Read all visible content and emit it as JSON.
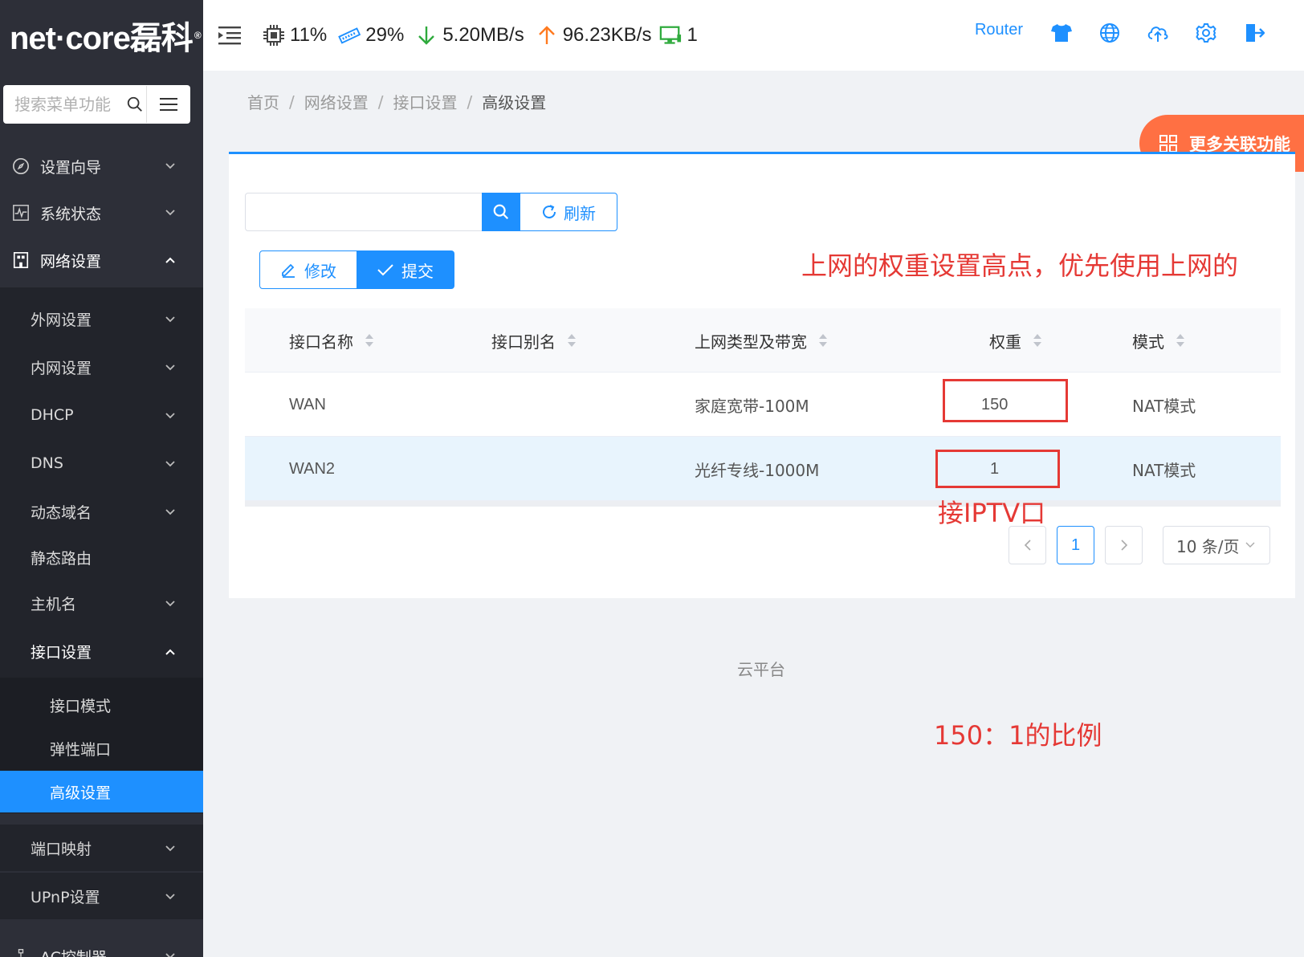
{
  "brand": {
    "logo_text": "net·core磊科",
    "reg": "®"
  },
  "sidebar": {
    "search_placeholder": "搜索菜单功能",
    "items": [
      {
        "label": "设置向导",
        "icon": "compass-icon"
      },
      {
        "label": "系统状态",
        "icon": "pulse-chart-icon"
      },
      {
        "label": "网络设置",
        "icon": "building-icon"
      }
    ],
    "network_sub": [
      {
        "label": "外网设置"
      },
      {
        "label": "内网设置"
      },
      {
        "label": "DHCP"
      },
      {
        "label": "DNS"
      },
      {
        "label": "动态域名"
      },
      {
        "label": "静态路由"
      },
      {
        "label": "主机名"
      },
      {
        "label": "接口设置"
      }
    ],
    "interface_sub": [
      {
        "label": "接口模式"
      },
      {
        "label": "弹性端口"
      },
      {
        "label": "高级设置"
      }
    ],
    "after_items": [
      {
        "label": "端口映射"
      },
      {
        "label": "UPnP设置"
      },
      {
        "label": "AC控制器"
      }
    ]
  },
  "topbar": {
    "cpu": "11%",
    "memory": "29%",
    "download": "5.20MB/s",
    "upload": "96.23KB/s",
    "clients": "1",
    "router_label": "Router"
  },
  "breadcrumb": [
    "首页",
    "网络设置",
    "接口设置",
    "高级设置"
  ],
  "more_button": "更多关联功能",
  "toolbar": {
    "refresh_label": "刷新",
    "edit_label": "修改",
    "submit_label": "提交"
  },
  "annotations": {
    "weight_note": "上网的权重设置高点，优先使用上网的",
    "iptv_note": "接IPTV口",
    "ratio_note": "150：1的比例"
  },
  "table": {
    "headers": [
      "接口名称",
      "接口别名",
      "上网类型及带宽",
      "权重",
      "模式"
    ],
    "rows": [
      {
        "name": "WAN",
        "alias": "",
        "type": "家庭宽带-100M",
        "weight": "150",
        "mode": "NAT模式"
      },
      {
        "name": "WAN2",
        "alias": "",
        "type": "光纤专线-1000M",
        "weight": "1",
        "mode": "NAT模式"
      }
    ]
  },
  "pagination": {
    "current": "1",
    "page_size": "10 条/页"
  },
  "footer": "云平台",
  "colors": {
    "accent": "#1e90ff",
    "sidebar_bg": "#2d2f38",
    "annotation": "#e53935",
    "more_btn": "#ff7043"
  }
}
